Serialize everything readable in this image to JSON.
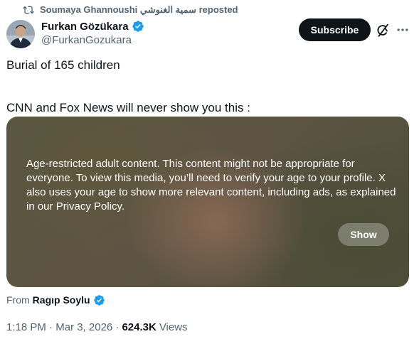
{
  "repost": {
    "icon": "repost-icon",
    "text": "Soumaya Ghannoushi سمية الغنوشي reposted"
  },
  "author": {
    "name": "Furkan Gözükara",
    "handle": "@FurkanGozukara",
    "verified": true
  },
  "header": {
    "subscribe_label": "Subscribe",
    "grok_icon": "grok-icon",
    "more_icon": "more-icon"
  },
  "tweet": {
    "line1": "Burial of 165 children",
    "line2": "CNN and Fox News will never show you this :"
  },
  "media": {
    "message": "Age-restricted adult content. This content might not be appropriate for everyone. To view this media, you’ll need to verify your age to your profile. X also uses your age to show more relevant content, including ads, as explained in our Privacy Policy.",
    "show_label": "Show"
  },
  "attribution": {
    "prefix": "From",
    "name": "Ragıp Soylu",
    "verified": true
  },
  "meta": {
    "time": "1:18 PM",
    "date": "Mar 3, 2026",
    "views_count": "624.3K",
    "views_label": "Views"
  },
  "colors": {
    "primary_text": "#0f1419",
    "secondary_text": "#536471",
    "verified_blue": "#1d9bf0",
    "subscribe_bg": "#0f1419"
  }
}
